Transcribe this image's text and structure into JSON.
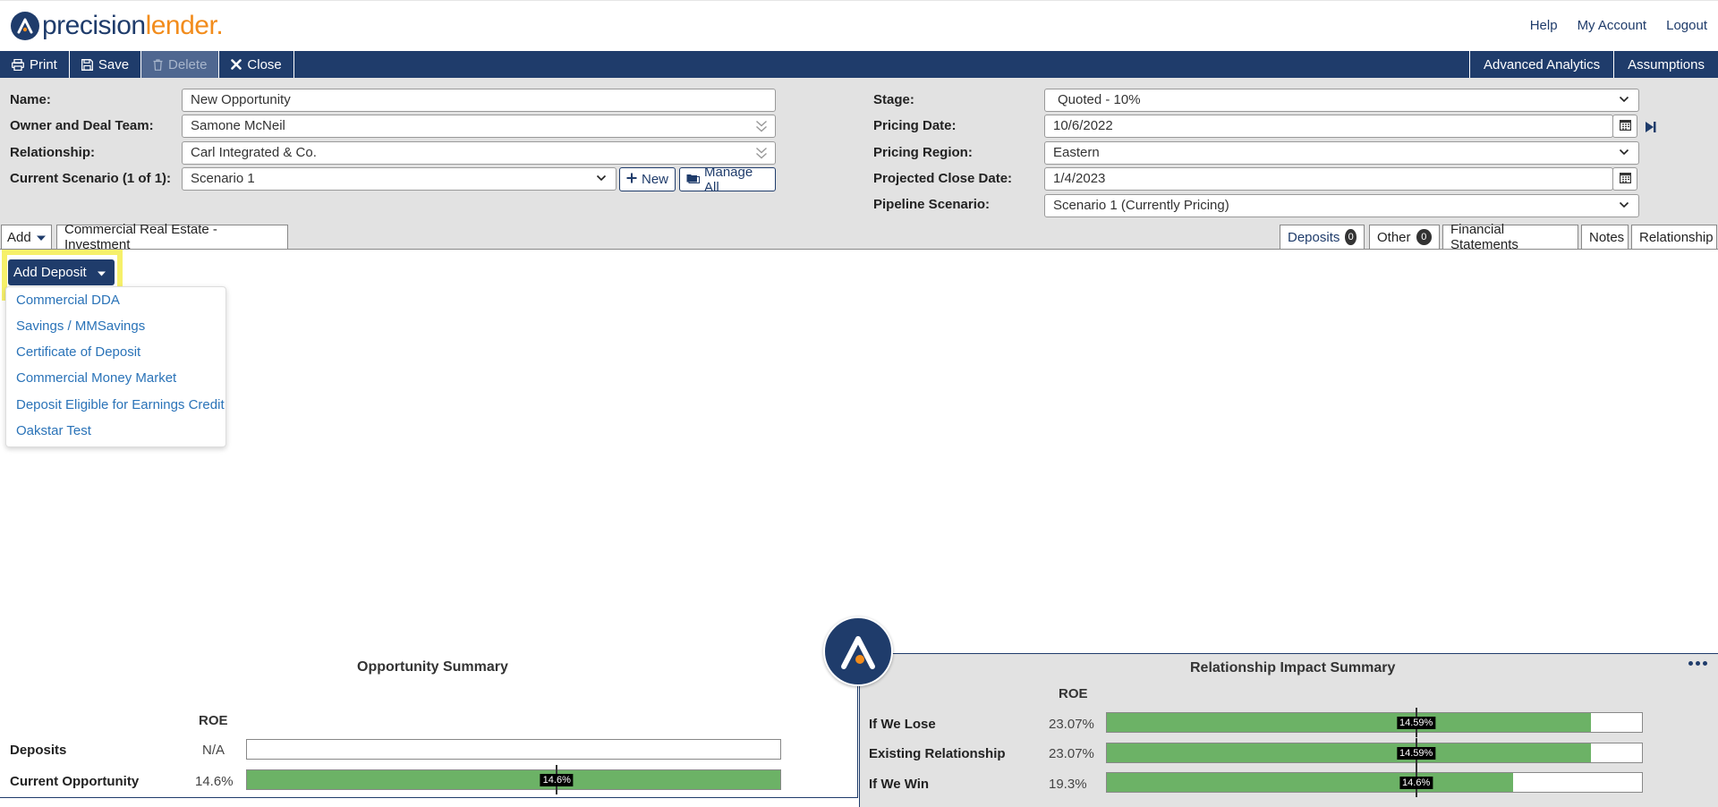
{
  "brand": {
    "part1": "precision",
    "part2": "lender",
    "dot": "."
  },
  "top_links": {
    "help": "Help",
    "account": "My Account",
    "logout": "Logout"
  },
  "toolbar": {
    "print": "Print",
    "save": "Save",
    "delete": "Delete",
    "close": "Close",
    "advanced_analytics": "Advanced Analytics",
    "assumptions": "Assumptions"
  },
  "form": {
    "name_label": "Name:",
    "name_value": "New Opportunity",
    "owner_label": "Owner and Deal Team:",
    "owner_value": "Samone McNeil",
    "relationship_label": "Relationship:",
    "relationship_value": "Carl Integrated & Co.",
    "scenario_label": "Current Scenario (1 of 1):",
    "scenario_value": "Scenario 1",
    "new_label": "New",
    "manage_all_label": "Manage All",
    "stage_label": "Stage:",
    "stage_value": "Quoted - 10%",
    "pricing_date_label": "Pricing Date:",
    "pricing_date_value": "10/6/2022",
    "pricing_region_label": "Pricing Region:",
    "pricing_region_value": "Eastern",
    "close_date_label": "Projected Close Date:",
    "close_date_value": "1/4/2023",
    "pipeline_label": "Pipeline Scenario:",
    "pipeline_value": "Scenario 1 (Currently Pricing)"
  },
  "tabs_left": {
    "add": "Add",
    "cre": "Commercial Real Estate - Investment"
  },
  "tabs_right": {
    "deposits": "Deposits",
    "deposits_count": "0",
    "other": "Other",
    "other_count": "0",
    "financial": "Financial Statements",
    "notes": "Notes",
    "relationship": "Relationship"
  },
  "add_deposit": {
    "button": "Add Deposit",
    "items": [
      "Commercial DDA",
      "Savings / MMSavings",
      "Certificate of Deposit",
      "Commercial Money Market",
      "Deposit Eligible for Earnings Credit",
      "Oakstar Test"
    ]
  },
  "opportunity_summary": {
    "title": "Opportunity Summary",
    "roe_header": "ROE",
    "rows": [
      {
        "label": "Deposits",
        "value": "N/A",
        "fill": 0
      },
      {
        "label": "Current Opportunity",
        "value": "14.6%",
        "fill": 1.0,
        "tick": 0.581,
        "tag": "14.6%"
      }
    ]
  },
  "relationship_summary": {
    "title": "Relationship Impact Summary",
    "roe_header": "ROE",
    "rows": [
      {
        "label": "If We Lose",
        "value": "23.07%",
        "fill": 0.904,
        "tick": 0.578,
        "tag": "14.59%"
      },
      {
        "label": "Existing Relationship",
        "value": "23.07%",
        "fill": 0.904,
        "tick": 0.578,
        "tag": "14.59%"
      },
      {
        "label": "If We Win",
        "value": "19.3%",
        "fill": 0.76,
        "tick": 0.578,
        "tag": "14.6%"
      }
    ]
  },
  "colors": {
    "brand_navy": "#1f3c6b",
    "brand_orange": "#f28c1c",
    "bar_green": "#6cb266",
    "highlight": "#f6f06a",
    "link_blue": "#2a73b8"
  }
}
